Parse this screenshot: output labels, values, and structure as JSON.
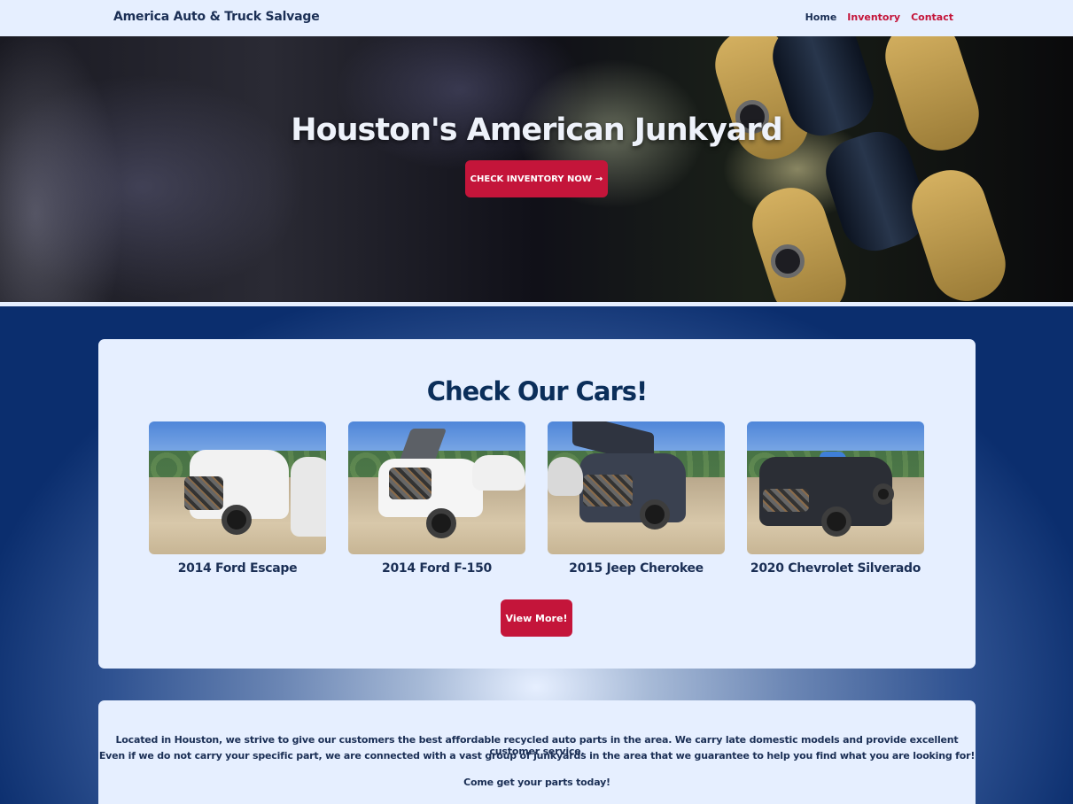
{
  "header": {
    "brand": "America Auto & Truck Salvage",
    "nav": [
      {
        "label": "Home"
      },
      {
        "label": "Inventory"
      },
      {
        "label": "Contact"
      }
    ]
  },
  "hero": {
    "title": "Houston's American Junkyard",
    "button_label": "CHECK INVENTORY NOW",
    "button_arrow": "→"
  },
  "cars_section": {
    "title": "Check Our Cars!",
    "cars": [
      {
        "label": "2014 Ford Escape",
        "color": "#f2f2f2"
      },
      {
        "label": "2014 Ford F-150",
        "color": "#f5f5f5"
      },
      {
        "label": "2015 Jeep Cherokee",
        "color": "#3a4150"
      },
      {
        "label": "2020 Chevrolet Silverado",
        "color": "#2b2e35"
      }
    ],
    "view_more_label": "View More!"
  },
  "about": {
    "line1": "Located in Houston, we strive to give our customers the best affordable recycled auto parts in the area. We carry late domestic models and provide excellent customer service.",
    "line2": "Even if we do not carry your specific part, we are connected with a vast group of junkyards in the area that we guarantee to help you find what you are looking for!",
    "line3": "Come get your parts today!"
  },
  "colors": {
    "accent": "#c4153a",
    "navy": "#1b2f55",
    "panel": "#e6efff"
  }
}
